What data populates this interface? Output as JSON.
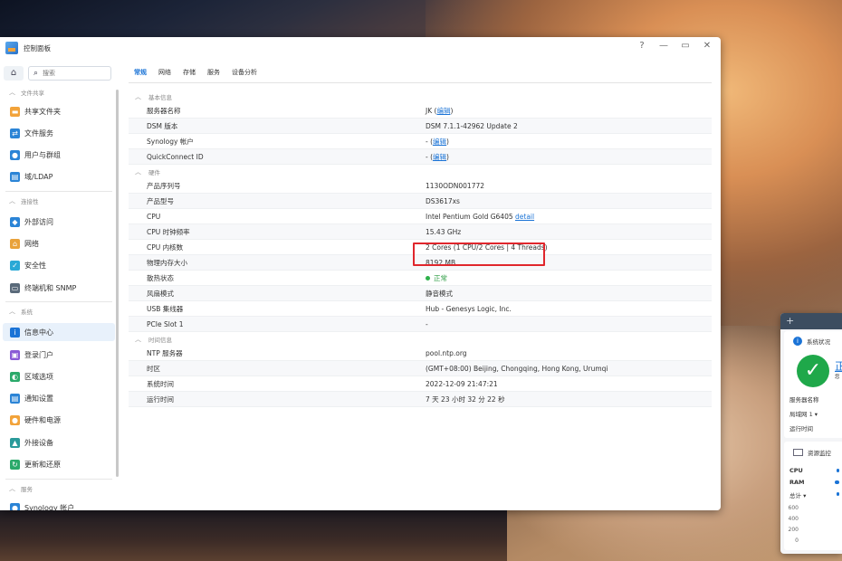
{
  "window": {
    "title": "控制面板",
    "controls": [
      "?",
      "—",
      "▭",
      "✕"
    ]
  },
  "sidebar": {
    "search_placeholder": "搜索",
    "categories": [
      "文件共享",
      "连接性",
      "系统",
      "服务"
    ],
    "items": [
      {
        "label": "共享文件夹",
        "color": "#f2a33a",
        "glyph": "▬"
      },
      {
        "label": "文件服务",
        "color": "#2b84d6",
        "glyph": "⇄"
      },
      {
        "label": "用户与群组",
        "color": "#2b84d6",
        "glyph": "●"
      },
      {
        "label": "域/LDAP",
        "color": "#2b84d6",
        "glyph": "▤"
      },
      {
        "label": "外部访问",
        "color": "#2b84d6",
        "glyph": "◆"
      },
      {
        "label": "网络",
        "color": "#e9a23b",
        "glyph": "⌂"
      },
      {
        "label": "安全性",
        "color": "#2aa9d6",
        "glyph": "✓"
      },
      {
        "label": "终端机和 SNMP",
        "color": "#5a6a7a",
        "glyph": "▭"
      },
      {
        "label": "信息中心",
        "color": "#1a73d6",
        "glyph": "i"
      },
      {
        "label": "登录门户",
        "color": "#8a5ad6",
        "glyph": "▣"
      },
      {
        "label": "区域选项",
        "color": "#2aa96a",
        "glyph": "◐"
      },
      {
        "label": "通知设置",
        "color": "#2b84d6",
        "glyph": "▤"
      },
      {
        "label": "硬件和电源",
        "color": "#f2a33a",
        "glyph": "●"
      },
      {
        "label": "外接设备",
        "color": "#2a9a9a",
        "glyph": "▲"
      },
      {
        "label": "更新和还原",
        "color": "#2aa96a",
        "glyph": "↻"
      },
      {
        "label": "Synology 帐户",
        "color": "#2b84d6",
        "glyph": "●"
      }
    ]
  },
  "tabs": [
    "常规",
    "网络",
    "存储",
    "服务",
    "设备分析"
  ],
  "sections": {
    "basic": "基本信息",
    "hardware": "硬件",
    "time": "时间信息"
  },
  "basic_rows": [
    {
      "k": "服务器名称",
      "v": "JK",
      "link": "编辑"
    },
    {
      "k": "DSM 版本",
      "v": "DSM 7.1.1-42962 Update 2",
      "link": ""
    },
    {
      "k": "Synology 帐户",
      "v": "-",
      "link": "编辑"
    },
    {
      "k": "QuickConnect ID",
      "v": "-",
      "link": "编辑"
    }
  ],
  "hardware_rows": [
    {
      "k": "产品序列号",
      "v": "1130ODN001772"
    },
    {
      "k": "产品型号",
      "v": "DS3617xs"
    },
    {
      "k": "CPU",
      "v": "Intel Pentium Gold G6405",
      "link": "detail"
    },
    {
      "k": "CPU 时钟频率",
      "v": "15.43 GHz"
    },
    {
      "k": "CPU 内核数",
      "v": "2 Cores (1 CPU/2 Cores | 4 Threads)"
    },
    {
      "k": "物理内存大小",
      "v": "8192 MB"
    },
    {
      "k": "散热状态",
      "v": "正常",
      "status": "ok"
    },
    {
      "k": "风扇模式",
      "v": "静音模式"
    },
    {
      "k": "USB 集线器",
      "v": "Hub - Genesys Logic, Inc."
    },
    {
      "k": "PCIe Slot 1",
      "v": "-"
    }
  ],
  "time_rows": [
    {
      "k": "NTP 服务器",
      "v": "pool.ntp.org"
    },
    {
      "k": "时区",
      "v": "(GMT+08:00) Beijing, Chongqing, Hong Kong, Urumqi"
    },
    {
      "k": "系统时间",
      "v": "2022-12-09 21:47:21"
    },
    {
      "k": "运行时间",
      "v": "7 天 23 小时 32 分 22 秒"
    }
  ],
  "widgets": {
    "add": "+",
    "status": {
      "title": "系统状况",
      "headline": "正",
      "sub": "您",
      "labels": [
        "服务器名称",
        "局域网 1 ▾",
        "运行时间"
      ]
    },
    "monitor": {
      "title": "资源监控",
      "labels": [
        "CPU",
        "RAM",
        "总计 ▾"
      ],
      "axis": [
        "600",
        "400",
        "200",
        "0"
      ]
    }
  }
}
